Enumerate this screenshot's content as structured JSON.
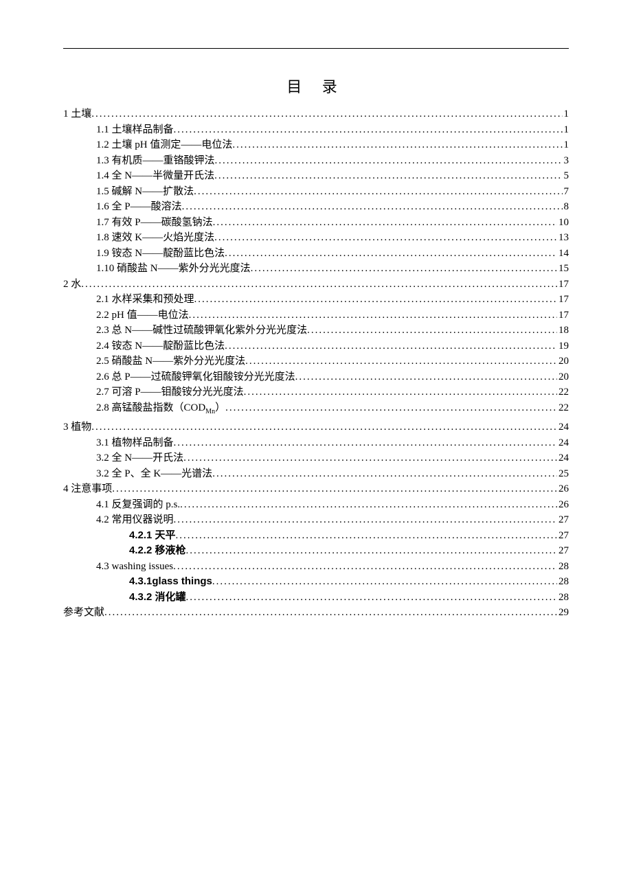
{
  "title": "目 录",
  "entries": [
    {
      "level": 1,
      "label": "1 土壤 ",
      "page": "1",
      "bold": false
    },
    {
      "level": 2,
      "label": "1.1 土壤样品制备 ",
      "page": "1",
      "bold": false
    },
    {
      "level": 2,
      "label": "1.2 土壤 pH 值测定——电位法 ",
      "page": "1",
      "bold": false
    },
    {
      "level": 2,
      "label": "1.3 有机质——重铬酸钾法 ",
      "page": "3",
      "bold": false
    },
    {
      "level": 2,
      "label": "1.4 全 N——半微量开氏法",
      "page": "5",
      "bold": false
    },
    {
      "level": 2,
      "label": "1.5 碱解 N——扩散法",
      "page": "7",
      "bold": false
    },
    {
      "level": 2,
      "label": "1.6 全 P——酸溶法",
      "page": "8",
      "bold": false
    },
    {
      "level": 2,
      "label": "1.7 有效 P——碳酸氢钠法",
      "page": "10",
      "bold": false
    },
    {
      "level": 2,
      "label": "1.8 速效 K——火焰光度法",
      "page": "13",
      "bold": false
    },
    {
      "level": 2,
      "label": "1.9 铵态 N——靛酚蓝比色法",
      "page": "14",
      "bold": false
    },
    {
      "level": 2,
      "label": "1.10 硝酸盐 N——紫外分光光度法",
      "page": "15",
      "bold": false
    },
    {
      "level": 1,
      "label": "2 水 ",
      "page": "17",
      "bold": false
    },
    {
      "level": 2,
      "label": "2.1 水样采集和预处理",
      "page": "17",
      "bold": false
    },
    {
      "level": 2,
      "label": "2.2 pH 值——电位法 ",
      "page": "17",
      "bold": false
    },
    {
      "level": 2,
      "label": "2.3 总 N——碱性过硫酸钾氧化紫外分光光度法",
      "page": "18",
      "bold": false
    },
    {
      "level": 2,
      "label": "2.4 铵态 N——靛酚蓝比色法",
      "page": "19",
      "bold": false
    },
    {
      "level": 2,
      "label": "2.5 硝酸盐 N——紫外分光光度法",
      "page": "20",
      "bold": false
    },
    {
      "level": 2,
      "label": "2.6 总 P——过硫酸钾氧化钼酸铵分光光度法",
      "page": "20",
      "bold": false
    },
    {
      "level": 2,
      "label": "2.7 可溶 P——钼酸铵分光光度法",
      "page": "22",
      "bold": false
    },
    {
      "level": 2,
      "label_html": "2.8 高锰酸盐指数（COD<span class='sub'>Mn</span>） ",
      "label": "2.8 高锰酸盐指数（CODMn） ",
      "page": "22",
      "bold": false
    },
    {
      "level": 1,
      "label": "3 植物 ",
      "page": "24",
      "bold": false
    },
    {
      "level": 2,
      "label": "3.1 植物样品制备 ",
      "page": "24",
      "bold": false
    },
    {
      "level": 2,
      "label": "3.2 全 N——开氏法",
      "page": "24",
      "bold": false
    },
    {
      "level": 2,
      "label": "3.2 全 P、全 K——光谱法 ",
      "page": "25",
      "bold": false
    },
    {
      "level": 1,
      "label": "4 注意事项 ",
      "page": "26",
      "bold": false
    },
    {
      "level": 2,
      "label": "4.1 反复强调的 p.s.",
      "page": "26",
      "bold": false
    },
    {
      "level": 2,
      "label": "4.2 常用仪器说明 ",
      "page": "27",
      "bold": false
    },
    {
      "level": 3,
      "label": "4.2.1 天平",
      "page": "27",
      "bold": true
    },
    {
      "level": 3,
      "label": "4.2.2 移液枪",
      "page": "27",
      "bold": true
    },
    {
      "level": 2,
      "label": "4.3 washing issues",
      "page": "28",
      "bold": false
    },
    {
      "level": 3,
      "label": "4.3.1glass things ",
      "page": "28",
      "bold": true
    },
    {
      "level": 3,
      "label": "4.3.2 消化罐",
      "page": "28",
      "bold": true
    },
    {
      "level": 1,
      "label": "参考文献 ",
      "page": "29",
      "bold": false
    }
  ]
}
